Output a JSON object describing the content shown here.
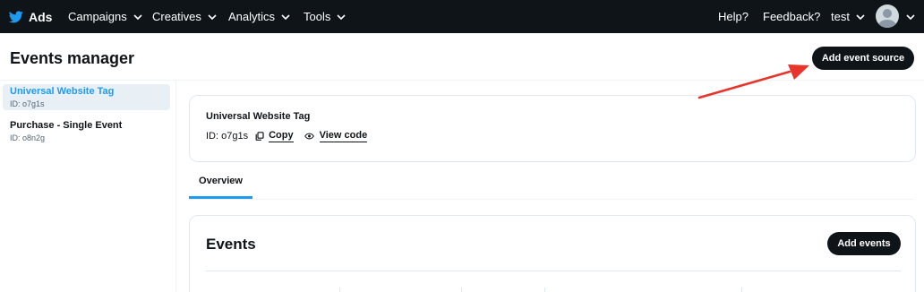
{
  "topbar": {
    "brand_label": "Ads",
    "nav": [
      {
        "label": "Campaigns"
      },
      {
        "label": "Creatives"
      },
      {
        "label": "Analytics"
      },
      {
        "label": "Tools"
      }
    ],
    "help_label": "Help?",
    "feedback_label": "Feedback?",
    "user_label": "test"
  },
  "header": {
    "title": "Events manager",
    "add_source_label": "Add event source"
  },
  "sidebar": {
    "items": [
      {
        "name": "Universal Website Tag",
        "id_text": "ID: o7g1s",
        "active": true
      },
      {
        "name": "Purchase - Single Event",
        "id_text": "ID: o8n2g",
        "active": false
      }
    ]
  },
  "tag_card": {
    "title": "Universal Website Tag",
    "id_text": "ID: o7g1s",
    "copy_label": "Copy",
    "view_code_label": "View code"
  },
  "tabs": [
    {
      "label": "Overview",
      "active": true
    }
  ],
  "events": {
    "title": "Events",
    "add_label": "Add events"
  },
  "colors": {
    "topbar_bg": "#0f1419",
    "accent": "#1d9bf0",
    "annotation_arrow": "#e8352b"
  }
}
